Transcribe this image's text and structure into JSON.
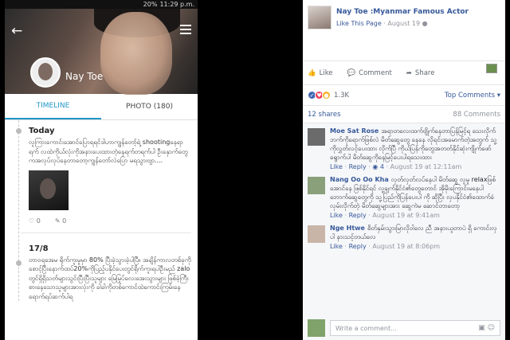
{
  "status": {
    "battery": "20%",
    "time": "11:29 p.m."
  },
  "profile": {
    "name": "Nay Toe",
    "tabs": [
      {
        "label": "TIMELINE"
      },
      {
        "label": "PHOTO (180)"
      }
    ]
  },
  "timeline": [
    {
      "head": "Today",
      "text": "လူကြားကောင်းအောင်ပြောရရင်ဒါဟာကျွန်တော့်ရဲ့ shootingနေရာရက် လထဲကိုယ်လုံးကိုအနားပေးထားတဲ့နေရက်တရက်ပါ ဦးနှောက်တွေကအလုပ်လုပ်နေတာတော့ကျွန်တော်လဲပြော မရသွားဗျာ....",
      "likes": "0",
      "comments": "0"
    },
    {
      "head": "17/8",
      "text": "တာဝရအေမ ရိုက်ကူးမှုမှာ 80% ပြီးခဲ့သွားခဲ့ပါပြီ။ အချိန်ကာလတစ်ခုကိုစောင့်ပြီးနောက်ထပ်20%ကိုပြည့်ပနိုင်ပေးတွင်ရိုက်ကူးရပါဦးမည် zalo တွင်ရှိရှိသတ်များသွင်းပြီးပြီးသူများ မြေမြုပ်လေးအေးသွားများ ဖြစ်ခဲ့ကြီးစားနေသောသူများအားလုံးကို ခါခါကိုတစ်ကောင်ထဲကောင်းကြမ်းနေရောက်ရပ်ဆက်ပါရ"
    }
  ],
  "post": {
    "page_name": "Nay Toe :Myanmar Famous Actor",
    "like_page": "Like This Page",
    "date": "August 19",
    "actions": [
      "Like",
      "Comment",
      "Share"
    ],
    "reactions_count": "1.3K",
    "top_comments": "Top Comments",
    "shares": "12 shares",
    "comments_count": "88 Comments"
  },
  "comments": [
    {
      "name": "Moe Sat Rose",
      "text": "အရာတလေးထက်ဗျိုက်နေတာပြန်မြင့်ရ သေးလိုက်ဘက်ကိုရောက်ဖြစ်လဲ မိတ်ဆွေတွေ နေနေ လိုရင်းအမောက်တဲ့အတွက် သူ့ကိုလွှတ်လင့်ပေးထား လိုက်ပြီ ကိုယ်ပြန်ကိုတွေအတတ်နိုင်ဆုံးကျိုက်ဖော်ရွောက်ပါ မိတ်ဆွေကိုနေမြင့်ပေးပါရသေးထား",
      "reply_count": "4",
      "time": "August 19 at 12:11am",
      "avatar_color": "#6b6b6b"
    },
    {
      "name": "Nang Oo Oo Kha",
      "text": "လှတ်လှတ်လပ်နေပါ မိတ်ဆွေ လူမှု relaxဖြစ်အောင်နေ ဖြစ်နိုင်ရင် လူ့ချက်နိုင်ငံ၏တွေတောင် အိုမိုးကြောင်းမနေပါ ဘောက်ဆွေတွေကို သူ့ပြည်ကိုပြန်ပေးပါ ကို ဆိုပြီး လှပနိုင်ငံ၏ထောက်ခံ လုမ်းလိုက်တဲ့ မိတ်ဆွေများအား ဆွေကဲမ ဆောင်တာတော့",
      "time": "August 19 at 9:41am",
      "avatar_color": "#8aa07a"
    },
    {
      "name": "Nge Htwe",
      "text": "စိတ်နှမ်းသွားမြာလိုဝါလေ ညီ အနားယူတာပဲ ရှိ ကောင်းလှပါ နားသင့်တယ်လေ",
      "time": "August 19 at 8:06pm",
      "avatar_color": "#c9b5a8"
    }
  ],
  "write": {
    "placeholder": "Write a comment..."
  }
}
